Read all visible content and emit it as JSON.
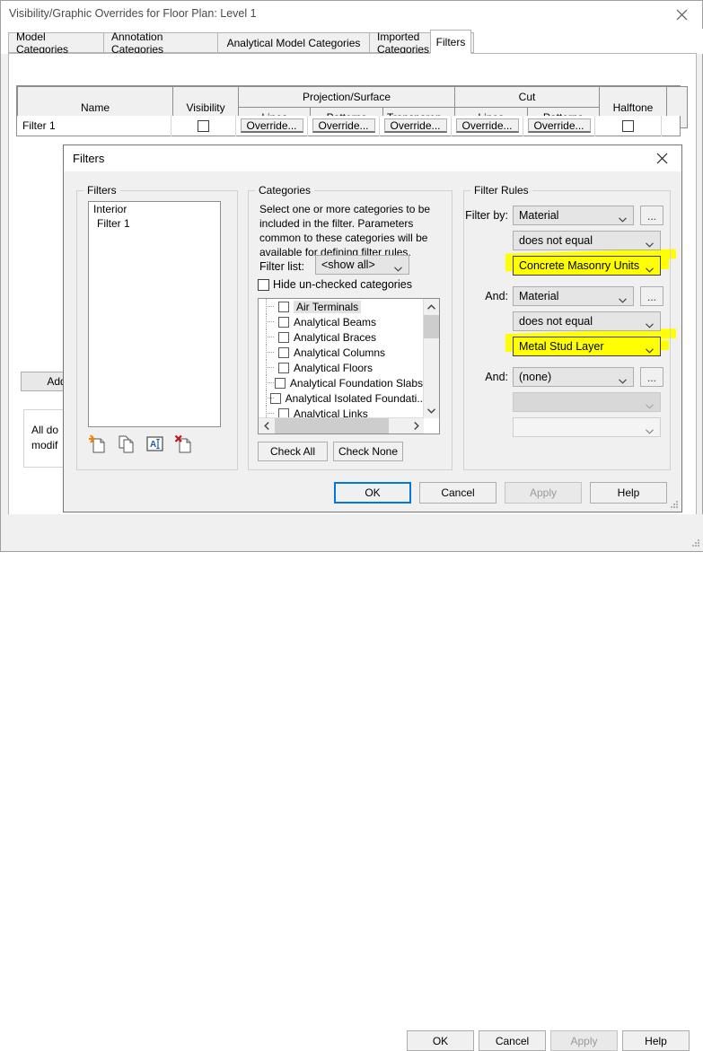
{
  "main_window": {
    "title": "Visibility/Graphic Overrides for Floor Plan: Level 1",
    "close_label": "✕",
    "tabs": [
      {
        "label": "Model Categories",
        "active": false
      },
      {
        "label": "Annotation Categories",
        "active": false
      },
      {
        "label": "Analytical Model Categories",
        "active": false
      },
      {
        "label": "Imported Categories",
        "active": false
      },
      {
        "label": "Filters",
        "active": true
      }
    ],
    "grid": {
      "headers": {
        "name": "Name",
        "visibility": "Visibility",
        "projection_surface": "Projection/Surface",
        "cut": "Cut",
        "halftone": "Halftone",
        "lines": "Lines",
        "patterns": "Patterns",
        "transparency": "Transparen...",
        "cut_lines": "Lines",
        "cut_patterns": "Patterns"
      },
      "rows": [
        {
          "name": "Filter 1",
          "visibility_checked": false,
          "override_label": "Override...",
          "overrides": [
            "Override...",
            "Override...",
            "Override...",
            "Override...",
            "Override..."
          ],
          "halftone_checked": false
        }
      ]
    },
    "add_button": "Add",
    "note_text_line1": "All do",
    "note_text_line2": "modif",
    "buttons": {
      "ok": "OK",
      "cancel": "Cancel",
      "apply": "Apply",
      "help": "Help"
    }
  },
  "filters_dialog": {
    "title": "Filters",
    "close_label": "✕",
    "filters_group": {
      "label": "Filters",
      "items": [
        {
          "label": "Interior",
          "selected": false
        },
        {
          "label": "Filter 1",
          "selected": true
        }
      ],
      "toolbar_icons": [
        {
          "name": "new-filter-icon",
          "tooltip": "New"
        },
        {
          "name": "duplicate-filter-icon",
          "tooltip": "Duplicate"
        },
        {
          "name": "rename-filter-icon",
          "tooltip": "Rename"
        },
        {
          "name": "delete-filter-icon",
          "tooltip": "Delete"
        }
      ]
    },
    "categories_group": {
      "label": "Categories",
      "description": "Select one or more categories to be included in the filter.  Parameters common to these categories will be available for defining filter rules.",
      "filter_list_label": "Filter list:",
      "filter_list_value": "<show all>",
      "hide_unchecked_label": "Hide un-checked categories",
      "hide_unchecked_checked": false,
      "category_items": [
        {
          "label": "Air Terminals",
          "checked": false,
          "highlighted": true
        },
        {
          "label": "Analytical Beams",
          "checked": false,
          "highlighted": false
        },
        {
          "label": "Analytical Braces",
          "checked": false,
          "highlighted": false
        },
        {
          "label": "Analytical Columns",
          "checked": false,
          "highlighted": false
        },
        {
          "label": "Analytical Floors",
          "checked": false,
          "highlighted": false
        },
        {
          "label": "Analytical Foundation Slabs",
          "checked": false,
          "highlighted": false
        },
        {
          "label": "Analytical Isolated Foundati..",
          "checked": false,
          "highlighted": false
        },
        {
          "label": "Analytical Links",
          "checked": false,
          "highlighted": false
        }
      ],
      "check_all_label": "Check All",
      "check_none_label": "Check None"
    },
    "filter_rules_group": {
      "label": "Filter Rules",
      "rows": [
        {
          "label": "Filter by:",
          "field": "Material",
          "operator": "does not equal",
          "value": "Concrete Masonry Units",
          "value_highlighted": true,
          "ellipsis": "...",
          "enabled": true
        },
        {
          "label": "And:",
          "field": "Material",
          "operator": "does not equal",
          "value": "Metal Stud Layer",
          "value_highlighted": true,
          "ellipsis": "...",
          "enabled": true
        },
        {
          "label": "And:",
          "field": "(none)",
          "operator": "",
          "value": "",
          "value_highlighted": false,
          "ellipsis": "...",
          "enabled": false
        }
      ]
    },
    "buttons": {
      "ok": "OK",
      "cancel": "Cancel",
      "apply": "Apply",
      "help": "Help"
    }
  },
  "colors": {
    "highlight_yellow": "#ffff00",
    "selection_blue": "#0a73d6",
    "default_button_border": "#0078d7",
    "dialog_bg": "#f0f0f0"
  }
}
